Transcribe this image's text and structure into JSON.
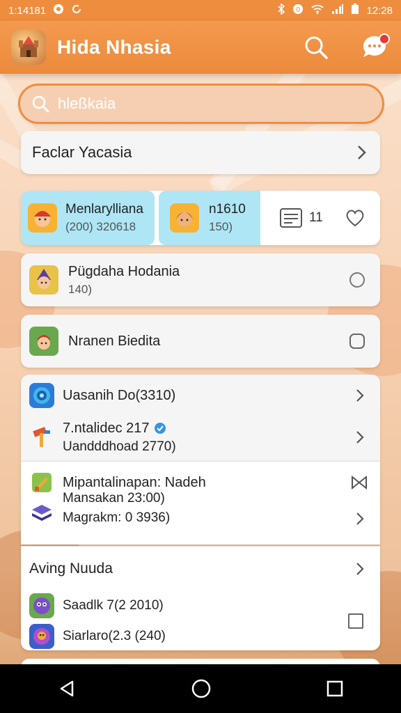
{
  "status_bar": {
    "time": "1:14181",
    "clock": "12:28"
  },
  "app_bar": {
    "title": "Hida Nhasia",
    "logo_icon": "castle-icon"
  },
  "search": {
    "placeholder": "hleßkaia"
  },
  "featured": {
    "label": "Faclar Yacasia"
  },
  "profiles": {
    "left": {
      "name": "Menlarylliana",
      "detail": "(200) 320618"
    },
    "middle": {
      "name": "n1610",
      "detail": "150)"
    },
    "count": "11"
  },
  "items": [
    {
      "title": "Pügdaha Hodania",
      "detail": "140)"
    },
    {
      "title": "Nranen Biedita"
    }
  ],
  "group1": {
    "rows": [
      {
        "title": "Uasanih Do(3310)"
      },
      {
        "title": "7.ntalidec 217",
        "detail": "Uandddhoad 2770)"
      }
    ]
  },
  "group2": {
    "header": "Mipantalinapan: Nadeh",
    "rows": [
      {
        "title": "Mansakan 23:00)"
      },
      {
        "title": "Magrakm: 0 3936)"
      }
    ]
  },
  "group3": {
    "header": "Aving Nuuda",
    "rows": [
      {
        "title": "Saadlk 7(2 2010)"
      },
      {
        "title": "Siarlaro(2.3 (240)"
      }
    ]
  },
  "colors": {
    "accent": "#ef8d3f",
    "highlight": "#aee6f5"
  }
}
